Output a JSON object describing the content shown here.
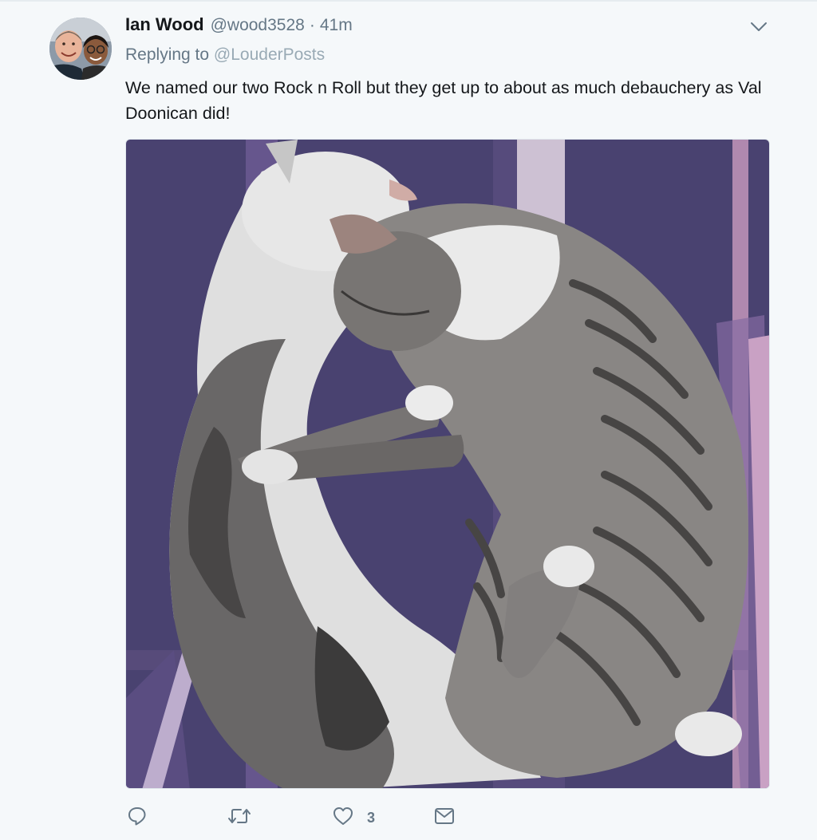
{
  "tweet": {
    "author_name": "Ian Wood",
    "author_handle": "@wood3528",
    "separator": "·",
    "timestamp": "41m",
    "replying_to_prefix": "Replying to",
    "replying_to_handle": "@LouderPosts",
    "text": "We named our two Rock n Roll but they get up to about as much debauchery as Val Doonican did!",
    "media": {
      "description_icon": "photo-of-two-cuddling-tabby-white-cats"
    }
  },
  "actions": {
    "reply": {
      "icon": "reply-icon",
      "count": ""
    },
    "retweet": {
      "icon": "retweet-icon",
      "count": ""
    },
    "like": {
      "icon": "heart-icon",
      "count": "3"
    },
    "dm": {
      "icon": "envelope-icon",
      "count": ""
    }
  },
  "menu": {
    "icon": "chevron-down-icon"
  },
  "colors": {
    "background": "#f5f8fa",
    "name": "#14171a",
    "secondary": "#657786",
    "link_muted": "#99aab5"
  }
}
